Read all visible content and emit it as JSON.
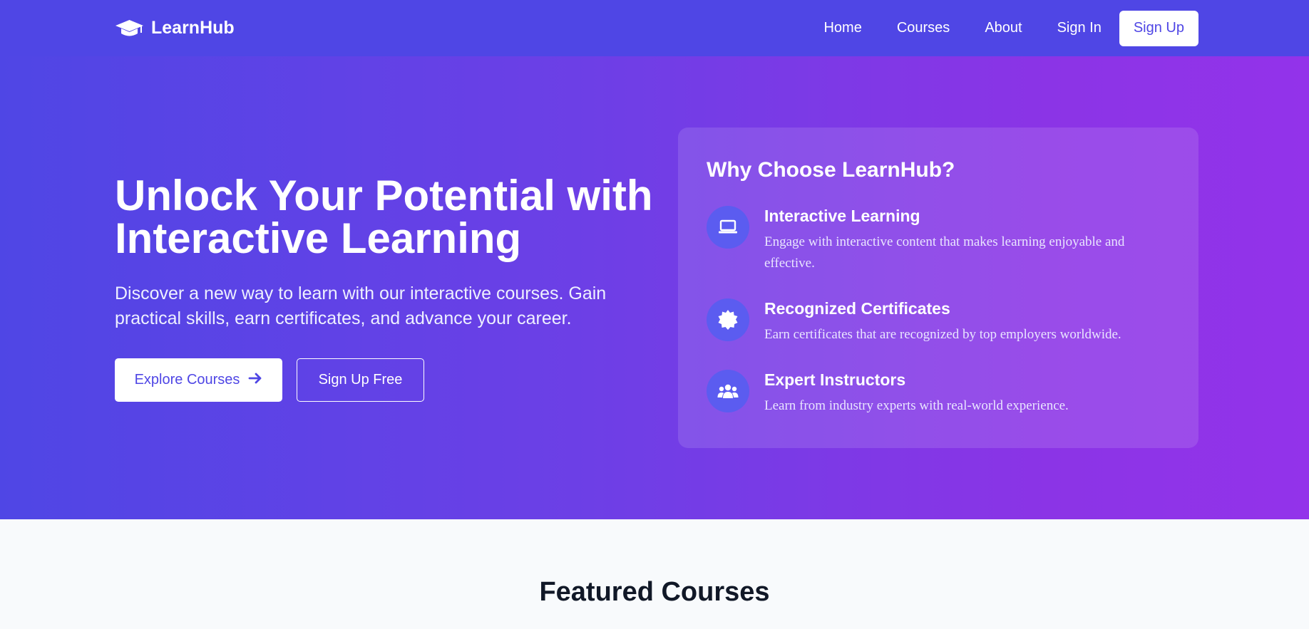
{
  "brand": {
    "name": "LearnHub",
    "icon": "graduation-cap-icon"
  },
  "nav": {
    "links": [
      "Home",
      "Courses",
      "About",
      "Sign In"
    ],
    "signup_label": "Sign Up"
  },
  "hero": {
    "title": "Unlock Your Potential with Interactive Learning",
    "subtitle": "Discover a new way to learn with our interactive courses. Gain practical skills, earn certificates, and advance your career.",
    "primary_button": "Explore Courses",
    "secondary_button": "Sign Up Free"
  },
  "why": {
    "title": "Why Choose LearnHub?",
    "features": [
      {
        "icon": "laptop-icon",
        "title": "Interactive Learning",
        "desc": "Engage with interactive content that makes learning enjoyable and effective."
      },
      {
        "icon": "certificate-icon",
        "title": "Recognized Certificates",
        "desc": "Earn certificates that are recognized by top employers worldwide."
      },
      {
        "icon": "users-icon",
        "title": "Expert Instructors",
        "desc": "Learn from industry experts with real-world experience."
      }
    ]
  },
  "featured": {
    "title": "Featured Courses"
  },
  "colors": {
    "primary": "#4f46e5",
    "accent": "#9333ea",
    "text_dark": "#111827"
  }
}
